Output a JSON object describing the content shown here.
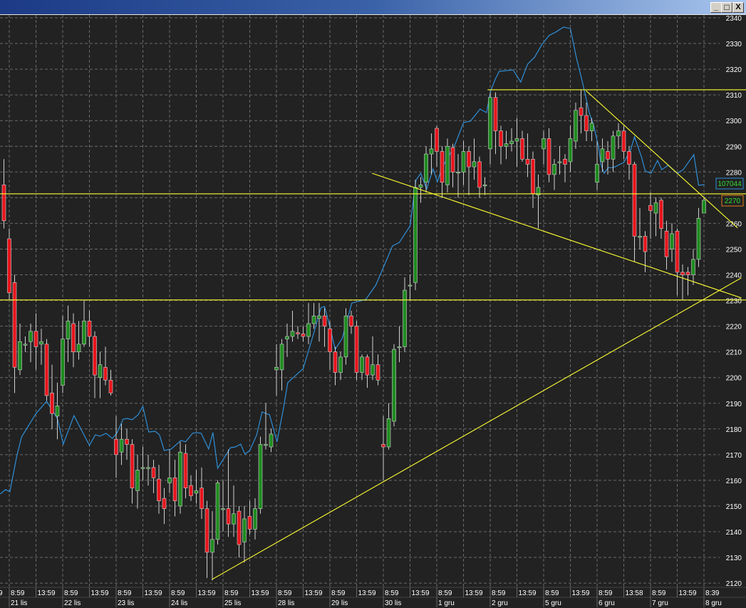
{
  "window": {
    "minimize_label": "_",
    "maximize_label": "□",
    "close_label": "X"
  },
  "chart_data": {
    "type": "candlestick",
    "title": "",
    "ylim": [
      2120,
      2340
    ],
    "y_ticks": [
      2340,
      2330,
      2320,
      2310,
      2300,
      2290,
      2280,
      2270,
      2260,
      2250,
      2240,
      2230,
      2220,
      2210,
      2200,
      2190,
      2180,
      2170,
      2160,
      2150,
      2140,
      2130,
      2120
    ],
    "grid": true,
    "time_label_partial": "9",
    "time_labels": [
      "8:59",
      "13:59",
      "8:59",
      "13:59",
      "8:59",
      "13:59",
      "8:59",
      "13:59",
      "8:59",
      "13:59",
      "8:59",
      "13:59",
      "8:59",
      "13:59",
      "8:59",
      "13:59",
      "8:59",
      "13:59",
      "8:59",
      "13:59",
      "8:59",
      "13:59",
      "8:59",
      "13:58",
      "8:59",
      "13:59",
      "8:39"
    ],
    "date_labels": [
      "21 lis",
      "22 lis",
      "23 lis",
      "24 lis",
      "25 lis",
      "28 lis",
      "29 lis",
      "30 lis",
      "1 gru",
      "2 gru",
      "5 gru",
      "6 gru",
      "7 gru",
      "8 gru"
    ],
    "candle_fields": [
      "open",
      "high",
      "low",
      "close"
    ],
    "candles": [
      [
        2275,
        2285,
        2258,
        2261
      ],
      [
        2254,
        2258,
        2230,
        2233
      ],
      [
        2237,
        2240,
        2194,
        2204
      ],
      [
        2203,
        2221,
        2201,
        2214
      ],
      [
        2213,
        2216,
        2210,
        2213
      ],
      [
        2214,
        2221,
        2206,
        2218
      ],
      [
        2218,
        2225,
        2203,
        2212
      ],
      [
        2213,
        2219,
        2205,
        2214
      ],
      [
        2213,
        2215,
        2191,
        2193
      ],
      [
        2194,
        2205,
        2180,
        2186
      ],
      [
        2185,
        2198,
        2176,
        2189
      ],
      [
        2197,
        2224,
        2194,
        2215
      ],
      [
        2215,
        2228,
        2206,
        2222
      ],
      [
        2221,
        2225,
        2204,
        2210
      ],
      [
        2210,
        2222,
        2207,
        2213
      ],
      [
        2213,
        2230,
        2212,
        2222
      ],
      [
        2222,
        2226,
        2212,
        2216
      ],
      [
        2216,
        2218,
        2192,
        2201
      ],
      [
        2200,
        2210,
        2192,
        2205
      ],
      [
        2204,
        2212,
        2197,
        2199
      ],
      [
        2199,
        2203,
        2193,
        2194
      ],
      [
        2176,
        2185,
        2161,
        2170
      ],
      [
        2171,
        2182,
        2166,
        2176
      ],
      [
        2176,
        2180,
        2168,
        2174
      ],
      [
        2174,
        2176,
        2151,
        2157
      ],
      [
        2156,
        2170,
        2149,
        2164
      ],
      [
        2165,
        2173,
        2160,
        2165
      ],
      [
        2165,
        2170,
        2158,
        2165
      ],
      [
        2165,
        2168,
        2155,
        2161
      ],
      [
        2160.5,
        2166,
        2147,
        2152
      ],
      [
        2153,
        2157,
        2143,
        2149
      ],
      [
        2159,
        2172,
        2155,
        2161
      ],
      [
        2161,
        2168,
        2146,
        2152
      ],
      [
        2150,
        2175,
        2147,
        2171
      ],
      [
        2170.5,
        2174,
        2153,
        2157
      ],
      [
        2158,
        2162,
        2152,
        2154
      ],
      [
        2155,
        2164,
        2151,
        2156
      ],
      [
        2157,
        2165,
        2145,
        2149
      ],
      [
        2149,
        2152,
        2122,
        2132
      ],
      [
        2132,
        2148,
        2121,
        2137
      ],
      [
        2137,
        2160,
        2135,
        2159
      ],
      [
        2149,
        2160,
        2140,
        2149
      ],
      [
        2149,
        2172,
        2138,
        2143
      ],
      [
        2143,
        2158,
        2138,
        2147
      ],
      [
        2148,
        2150,
        2130,
        2135
      ],
      [
        2136,
        2150,
        2128,
        2145
      ],
      [
        2146,
        2152,
        2139,
        2141
      ],
      [
        2141,
        2153,
        2137,
        2149
      ],
      [
        2149,
        2177,
        2147,
        2174
      ],
      [
        2174,
        2190,
        2172,
        2174
      ],
      [
        2173,
        2180,
        2171,
        2178
      ],
      [
        2203,
        2213,
        2193,
        2204
      ],
      [
        2203,
        2215,
        2195,
        2213
      ],
      [
        2215,
        2221,
        2208,
        2216
      ],
      [
        2216,
        2226,
        2214,
        2218
      ],
      [
        2217.5,
        2220,
        2215,
        2217
      ],
      [
        2217,
        2220,
        2214,
        2216
      ],
      [
        2216,
        2229,
        2213,
        2221
      ],
      [
        2221,
        2229,
        2219,
        2224
      ],
      [
        2223,
        2229,
        2214,
        2224
      ],
      [
        2224,
        2227,
        2212,
        2220
      ],
      [
        2219,
        2222,
        2203,
        2210
      ],
      [
        2210,
        2212,
        2197,
        2202
      ],
      [
        2202,
        2210,
        2199,
        2208
      ],
      [
        2208,
        2227,
        2205,
        2224
      ],
      [
        2224,
        2226,
        2217,
        2220
      ],
      [
        2220,
        2222,
        2199,
        2202
      ],
      [
        2202,
        2209,
        2199,
        2208
      ],
      [
        2208,
        2209,
        2196,
        2201
      ],
      [
        2201,
        2216,
        2199,
        2205
      ],
      [
        2205,
        2209,
        2197,
        2199
      ],
      [
        2174,
        2185,
        2160,
        2173
      ],
      [
        2173,
        2190,
        2172,
        2184
      ],
      [
        2183,
        2213,
        2181,
        2211
      ],
      [
        2212,
        2220,
        2206,
        2212
      ],
      [
        2212,
        2239,
        2210,
        2234
      ],
      [
        2236,
        2240,
        2230,
        2236
      ],
      [
        2237,
        2277,
        2234,
        2274
      ],
      [
        2274,
        2278,
        2268,
        2275
      ],
      [
        2276,
        2290,
        2272,
        2287
      ],
      [
        2287,
        2295,
        2279,
        2289
      ],
      [
        2297,
        2298,
        2282,
        2288
      ],
      [
        2288,
        2290,
        2270,
        2276
      ],
      [
        2275,
        2293,
        2272,
        2290
      ],
      [
        2289.5,
        2291,
        2274,
        2280
      ],
      [
        2280,
        2287,
        2270,
        2280
      ],
      [
        2280,
        2292,
        2275,
        2288
      ],
      [
        2288,
        2290,
        2271,
        2282
      ],
      [
        2282,
        2293,
        2277,
        2284
      ],
      [
        2284,
        2286,
        2270,
        2274
      ],
      [
        2275,
        2278,
        2271,
        2275
      ],
      [
        2289,
        2311,
        2283,
        2309
      ],
      [
        2309,
        2311,
        2287,
        2296
      ],
      [
        2296,
        2298,
        2283,
        2290
      ],
      [
        2290,
        2296,
        2285,
        2291
      ],
      [
        2291,
        2297,
        2288,
        2292
      ],
      [
        2292,
        2301,
        2282,
        2293
      ],
      [
        2293,
        2296,
        2284,
        2285
      ],
      [
        2285,
        2295,
        2278,
        2283
      ],
      [
        2285,
        2288,
        2266,
        2271.5
      ],
      [
        2271,
        2279,
        2258,
        2274
      ],
      [
        2289,
        2296,
        2283,
        2293
      ],
      [
        2293,
        2297,
        2276,
        2279
      ],
      [
        2279,
        2285,
        2273,
        2283
      ],
      [
        2284,
        2290,
        2279,
        2284
      ],
      [
        2285,
        2287,
        2276,
        2283
      ],
      [
        2284,
        2298,
        2280,
        2293
      ],
      [
        2292,
        2307,
        2289,
        2304
      ],
      [
        2305,
        2312,
        2295,
        2302
      ],
      [
        2302,
        2307,
        2292,
        2296
      ],
      [
        2296,
        2301,
        2292,
        2299
      ],
      [
        2276,
        2292,
        2273,
        2283
      ],
      [
        2284,
        2293,
        2280,
        2289
      ],
      [
        2288,
        2292,
        2279,
        2285
      ],
      [
        2285,
        2296,
        2280,
        2294
      ],
      [
        2294,
        2299,
        2289,
        2296
      ],
      [
        2296,
        2298,
        2285,
        2288
      ],
      [
        2288,
        2290,
        2277,
        2283
      ],
      [
        2283,
        2284,
        2245,
        2255
      ],
      [
        2255,
        2266,
        2250,
        2255
      ],
      [
        2255,
        2257,
        2241,
        2249
      ],
      [
        2267,
        2272,
        2254,
        2265
      ],
      [
        2264,
        2270,
        2255,
        2268
      ],
      [
        2269,
        2270,
        2254,
        2258
      ],
      [
        2257,
        2261,
        2242,
        2247
      ],
      [
        2250,
        2260,
        2245,
        2256
      ],
      [
        2257,
        2258,
        2232,
        2241
      ],
      [
        2241,
        2244,
        2230,
        2240
      ],
      [
        2241,
        2243,
        2232,
        2240
      ],
      [
        2240,
        2250,
        2236,
        2246
      ],
      [
        2246,
        2266,
        2243,
        2262
      ],
      [
        2264,
        2270,
        2264,
        2269
      ]
    ],
    "indicator": {
      "color": "#2f8fd8",
      "last_value_label": "107044",
      "points": [
        [
          -0.7,
          2154.7
        ],
        [
          0.3,
          2156.4
        ],
        [
          1.1,
          2155.5
        ],
        [
          2.4,
          2169.4
        ],
        [
          3.3,
          2176.9
        ],
        [
          6,
          2186
        ],
        [
          8,
          2190.8
        ],
        [
          10,
          2184.1
        ],
        [
          11.1,
          2174.1
        ],
        [
          13.1,
          2185.2
        ],
        [
          16,
          2173.6
        ],
        [
          17.1,
          2177.7
        ],
        [
          18,
          2177.2
        ],
        [
          19.1,
          2178.3
        ],
        [
          20.3,
          2176.3
        ],
        [
          21.1,
          2178.3
        ],
        [
          22.3,
          2183.8
        ],
        [
          23.1,
          2184.1
        ],
        [
          24,
          2183.6
        ],
        [
          25.1,
          2185.5
        ],
        [
          26,
          2188.8
        ],
        [
          27.1,
          2178.8
        ],
        [
          28.3,
          2179.1
        ],
        [
          29.1,
          2177.7
        ],
        [
          30,
          2171.6
        ],
        [
          31.3,
          2172.2
        ],
        [
          33.1,
          2175.5
        ],
        [
          34,
          2175
        ],
        [
          35.3,
          2178.3
        ],
        [
          36,
          2178.6
        ],
        [
          36.9,
          2178.3
        ],
        [
          38.3,
          2172.2
        ],
        [
          39.1,
          2178.6
        ],
        [
          40,
          2164.7
        ],
        [
          42.4,
          2172.7
        ],
        [
          43.3,
          2173
        ],
        [
          44.3,
          2174.1
        ],
        [
          45.1,
          2170.2
        ],
        [
          46,
          2171.6
        ],
        [
          47.3,
          2177.7
        ],
        [
          48.3,
          2186.6
        ],
        [
          49.7,
          2185.5
        ],
        [
          51.1,
          2175
        ],
        [
          52.3,
          2188
        ],
        [
          53.1,
          2198
        ],
        [
          56,
          2203.5
        ],
        [
          58,
          2217.4
        ],
        [
          59.3,
          2227.1
        ],
        [
          60,
          2227.7
        ],
        [
          60.7,
          2222.1
        ],
        [
          62,
          2211
        ],
        [
          63.3,
          2215.2
        ],
        [
          65.1,
          2229
        ],
        [
          67.7,
          2230.4
        ],
        [
          69.6,
          2236
        ],
        [
          71.3,
          2244.3
        ],
        [
          72.7,
          2251.2
        ],
        [
          74,
          2252.6
        ],
        [
          76,
          2259
        ],
        [
          77.1,
          2276.8
        ],
        [
          78,
          2279.5
        ],
        [
          79.1,
          2273.4
        ],
        [
          80.3,
          2281.2
        ],
        [
          81.1,
          2276.2
        ],
        [
          82,
          2281.7
        ],
        [
          84.3,
          2290.1
        ],
        [
          86,
          2299.2
        ],
        [
          87.3,
          2299.8
        ],
        [
          89.1,
          2304.5
        ],
        [
          90.3,
          2303.1
        ],
        [
          91.1,
          2311.7
        ],
        [
          92,
          2316.4
        ],
        [
          92.7,
          2319.2
        ],
        [
          95.3,
          2319.7
        ],
        [
          96.7,
          2315
        ],
        [
          98,
          2322
        ],
        [
          99.3,
          2324.7
        ],
        [
          100.7,
          2329.7
        ],
        [
          102,
          2333.1
        ],
        [
          103.3,
          2334.5
        ],
        [
          104.7,
          2336.4
        ],
        [
          106,
          2335.8
        ],
        [
          107.1,
          2324.7
        ],
        [
          108.3,
          2314.5
        ],
        [
          109.6,
          2302.6
        ],
        [
          110.4,
          2297.8
        ],
        [
          111.3,
          2289.5
        ],
        [
          111.7,
          2283.1
        ],
        [
          112.3,
          2279.5
        ],
        [
          113.1,
          2281.7
        ],
        [
          114,
          2281.7
        ],
        [
          116,
          2283.7
        ],
        [
          117.3,
          2288.7
        ],
        [
          118,
          2293.7
        ],
        [
          119.3,
          2285.9
        ],
        [
          120,
          2280.4
        ],
        [
          121.1,
          2279.5
        ],
        [
          122.3,
          2284.5
        ],
        [
          123.1,
          2280.9
        ],
        [
          124.3,
          2282.6
        ],
        [
          126,
          2279.5
        ],
        [
          127.1,
          2280.9
        ],
        [
          129.1,
          2286.7
        ],
        [
          130,
          2274.8
        ],
        [
          131.1,
          2275.1
        ]
      ]
    },
    "price_marker_label": "2270",
    "horizontal_lines": [
      {
        "price": 2312,
        "from_index": 90.5
      },
      {
        "price": 2271.5,
        "from_index": -1
      },
      {
        "price": 2230.2,
        "from_index": -1
      }
    ],
    "trend_lines": [
      {
        "from": [
          38.9,
          2121.4
        ],
        "to": [
          138,
          2238.8
        ]
      },
      {
        "from": [
          68.9,
          2279.5
        ],
        "to": [
          138,
          2231
        ]
      },
      {
        "from": [
          108.9,
          2311.7
        ],
        "to": [
          137.3,
          2258.2
        ]
      }
    ],
    "colors": {
      "up": "#1e8c1e",
      "down": "#e8141c",
      "wick": "#d0d0d0",
      "trend": "#ffff33",
      "grid": "#6a6a6a",
      "indicator_box_border": "#2f8fd8",
      "price_box_border": "#e07a1a",
      "box_text": "#33dd33"
    }
  }
}
